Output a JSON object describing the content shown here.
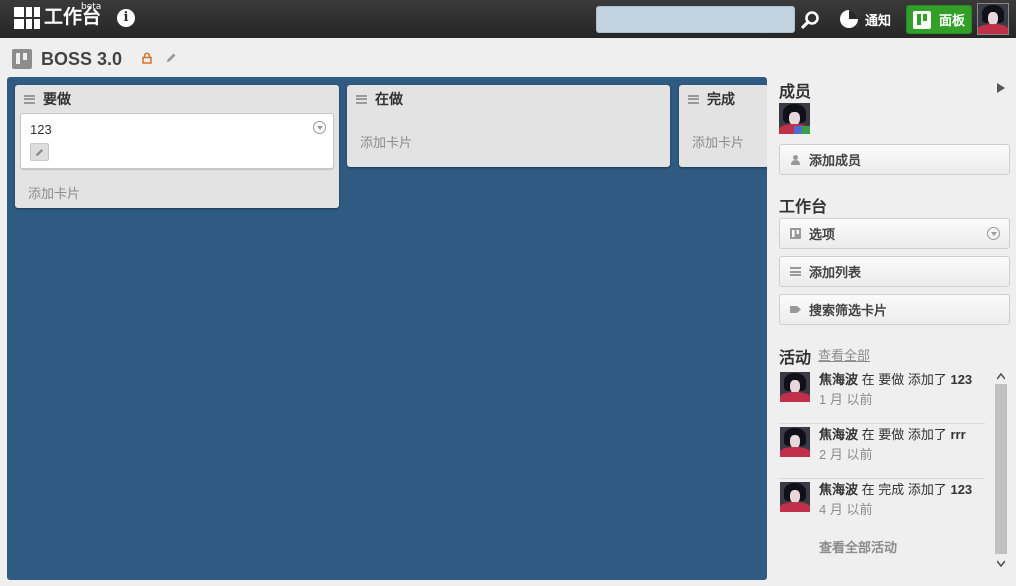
{
  "header": {
    "logo_text": "工作台",
    "logo_badge": "beta",
    "info_label": "i",
    "search_placeholder": "",
    "notify_label": "通知",
    "boards_label": "面板"
  },
  "board": {
    "title": "BOSS 3.0",
    "lists": [
      {
        "title": "要做",
        "cards": [
          {
            "title": "123"
          }
        ],
        "add_card": "添加卡片"
      },
      {
        "title": "在做",
        "cards": [],
        "add_card": "添加卡片"
      },
      {
        "title": "完成",
        "cards": [],
        "add_card": "添加卡片"
      }
    ]
  },
  "sidebar": {
    "members_heading": "成员",
    "add_member": "添加成员",
    "workbench_heading": "工作台",
    "options": "选项",
    "add_list": "添加列表",
    "filter_cards": "搜索筛选卡片",
    "activity_heading": "活动",
    "view_all": "查看全部",
    "view_all_activity": "查看全部活动",
    "activities": [
      {
        "user": "焦海波",
        "text": " 在 要做 添加了 ",
        "item": "123",
        "time": "1 月 以前"
      },
      {
        "user": "焦海波",
        "text": " 在 要做 添加了 ",
        "item": "rrr",
        "time": "2 月 以前"
      },
      {
        "user": "焦海波",
        "text": " 在 完成 添加了 ",
        "item": "123",
        "time": "4 月 以前"
      }
    ]
  },
  "colors": {
    "board_bg": "#2f5b82",
    "topbar": "#2e2e2e",
    "boards_btn": "#32a028",
    "list_bg": "#e3e3e3"
  },
  "icons": [
    "logo-icon",
    "info-icon",
    "search-icon",
    "notification-icon",
    "boards-icon",
    "board-icon",
    "lock-icon",
    "pencil-icon",
    "list-menu-icon",
    "card-menu-icon",
    "person-icon",
    "tag-icon",
    "filter-icon",
    "chevron-right-icon"
  ]
}
